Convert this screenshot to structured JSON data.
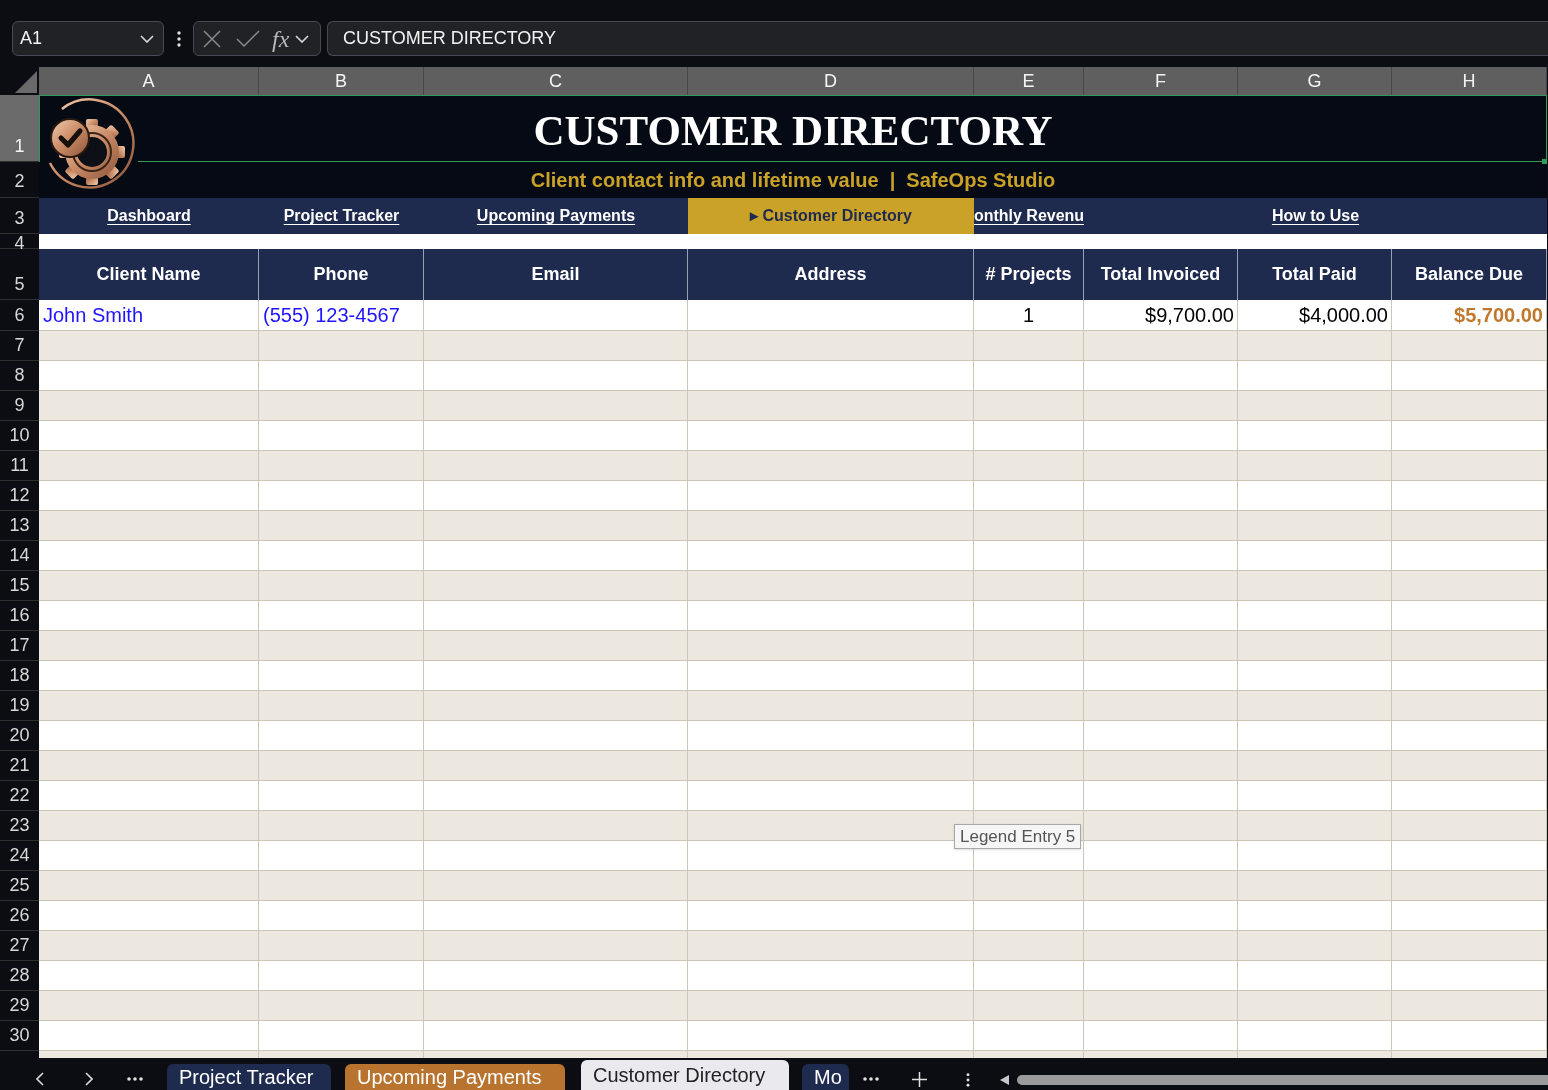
{
  "formula_bar": {
    "name_box": "A1",
    "function_label": "fx",
    "formula": "CUSTOMER DIRECTORY"
  },
  "column_headers": [
    "A",
    "B",
    "C",
    "D",
    "E",
    "F",
    "G",
    "H"
  ],
  "row_headers": [
    "1",
    "2",
    "3",
    "4",
    "5",
    "6",
    "7",
    "8",
    "9",
    "10",
    "11",
    "12",
    "13",
    "14",
    "15",
    "16",
    "17",
    "18",
    "19",
    "20",
    "21",
    "22",
    "23",
    "24",
    "25",
    "26",
    "27",
    "28",
    "29",
    "30"
  ],
  "banner": {
    "title": "CUSTOMER DIRECTORY",
    "subtitle": "Client contact info and lifetime value  |  SafeOps Studio"
  },
  "navigation": [
    {
      "label": "Dashboard",
      "selected": false
    },
    {
      "label": "Project Tracker",
      "selected": false
    },
    {
      "label": "Upcoming Payments",
      "selected": false
    },
    {
      "label": "▸ Customer Directory",
      "selected": true
    },
    {
      "label": "onthly Revenu",
      "selected": false
    },
    {
      "label": "How to Use",
      "selected": false
    }
  ],
  "table": {
    "columns": [
      "Client Name",
      "Phone",
      "Email",
      "Address",
      "# Projects",
      "Total Invoiced",
      "Total Paid",
      "Balance Due"
    ],
    "rows": [
      [
        "John Smith",
        "(555) 123-4567",
        null,
        null,
        "1",
        "$9,700.00",
        "$4,000.00",
        "$5,700.00"
      ]
    ]
  },
  "tooltip": "Legend Entry 5",
  "sheet_tabs": [
    {
      "label": "Project Tracker",
      "selected": false,
      "color": "#1f2a4f"
    },
    {
      "label": "Upcoming Payments",
      "selected": false,
      "color": "#b8732f"
    },
    {
      "label": "Customer Directory",
      "selected": true
    },
    {
      "label": "Mo",
      "selected": false,
      "color": "#1f2a4f"
    }
  ]
}
